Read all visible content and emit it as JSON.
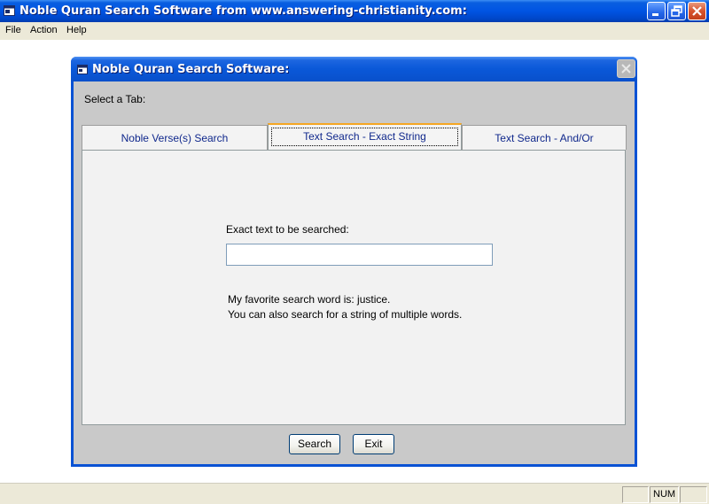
{
  "window": {
    "title": "Noble Quran Search Software from www.answering-christianity.com:"
  },
  "menu": {
    "items": [
      "File",
      "Action",
      "Help"
    ]
  },
  "dialog": {
    "title": "Noble Quran Search Software:",
    "select_tab_label": "Select a Tab:",
    "tabs": [
      {
        "label": "Noble Verse(s) Search",
        "active": false
      },
      {
        "label": "Text Search - Exact String",
        "active": true
      },
      {
        "label": "Text Search - And/Or",
        "active": false
      }
    ],
    "panel": {
      "field_label": "Exact text to be searched:",
      "input_value": "",
      "hint_line1": "My favorite search word is:  justice.",
      "hint_line2": "You can also search for a string of multiple words."
    },
    "buttons": {
      "search": "Search",
      "exit": "Exit"
    }
  },
  "statusbar": {
    "panel_empty": "",
    "num": "NUM"
  },
  "colors": {
    "titlebar_blue": "#0054e3",
    "tab_text": "#10288c",
    "active_tab_accent": "#f5a623",
    "close_button_red": "#d7532c"
  },
  "icons": {
    "app": "app-window-icon",
    "minimize": "minimize-icon",
    "restore": "restore-icon",
    "close": "close-icon"
  }
}
